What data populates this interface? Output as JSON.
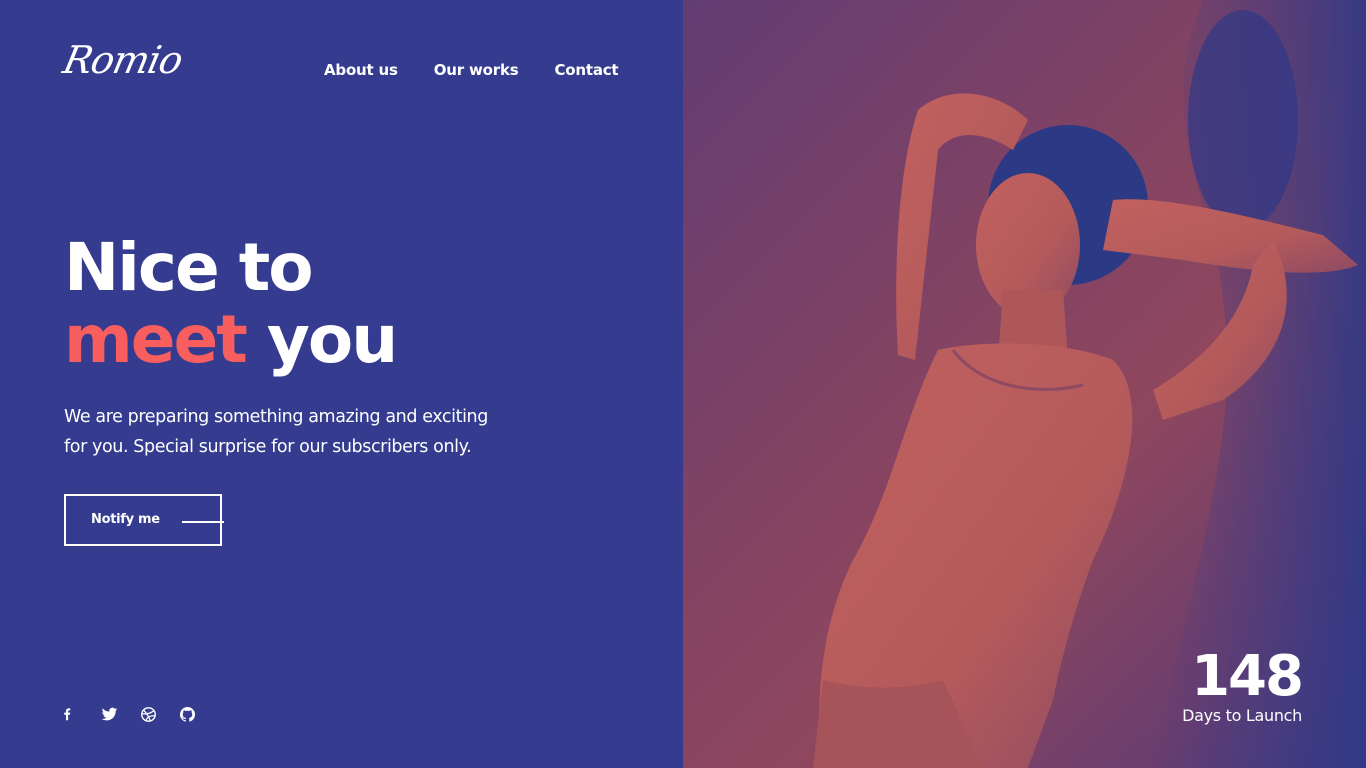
{
  "logo": {
    "text": "Romio"
  },
  "nav": {
    "items": [
      {
        "label": "About us"
      },
      {
        "label": "Our works"
      },
      {
        "label": "Contact"
      }
    ]
  },
  "hero": {
    "line1": "Nice to",
    "line2_accent": "meet",
    "line2_rest": "you",
    "subtext_line1": "We are preparing something amazing and exciting",
    "subtext_line2": "for you. Special surprise for our subscribers only.",
    "cta_label": "Notify me"
  },
  "social": {
    "icons": [
      "facebook-icon",
      "twitter-icon",
      "dribbble-icon",
      "github-icon"
    ]
  },
  "countdown": {
    "value": "148",
    "caption": "Days to Launch"
  },
  "colors": {
    "left_bg": "#353c8f",
    "accent": "#f85e5e",
    "text": "#ffffff"
  }
}
